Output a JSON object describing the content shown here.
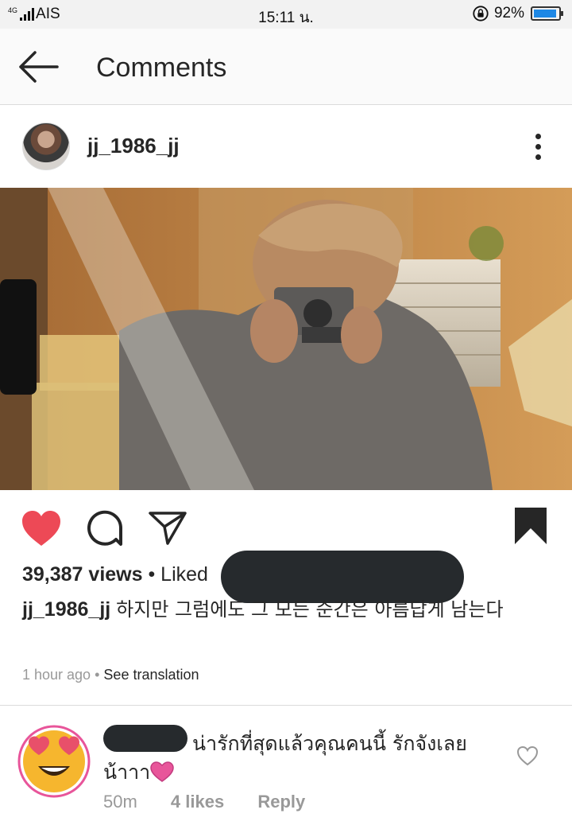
{
  "status_bar": {
    "network": "4G",
    "carrier": "AIS",
    "time": "15:11 น.",
    "battery": "92%",
    "battery_level": 0.92
  },
  "header": {
    "title": "Comments"
  },
  "post": {
    "username": "jj_1986_jj",
    "views": "39,387 views",
    "liked_prefix": "• Liked",
    "caption": "하지만 그럼에도 그 모든 순간은 아름답게 남는다",
    "time_ago": "1 hour ago",
    "translate_separator": "•",
    "see_translation": "See translation"
  },
  "comment": {
    "text_line1": "น่ารักที่สุดแล้วคุณคนนี้ รักจังเลย",
    "text_line2": "น้าาา",
    "time": "50m",
    "likes": "4 likes",
    "reply": "Reply"
  },
  "colors": {
    "heart_liked": "#ed4956",
    "pink_heart": "#e8559a",
    "battery": "#1e88e5"
  }
}
